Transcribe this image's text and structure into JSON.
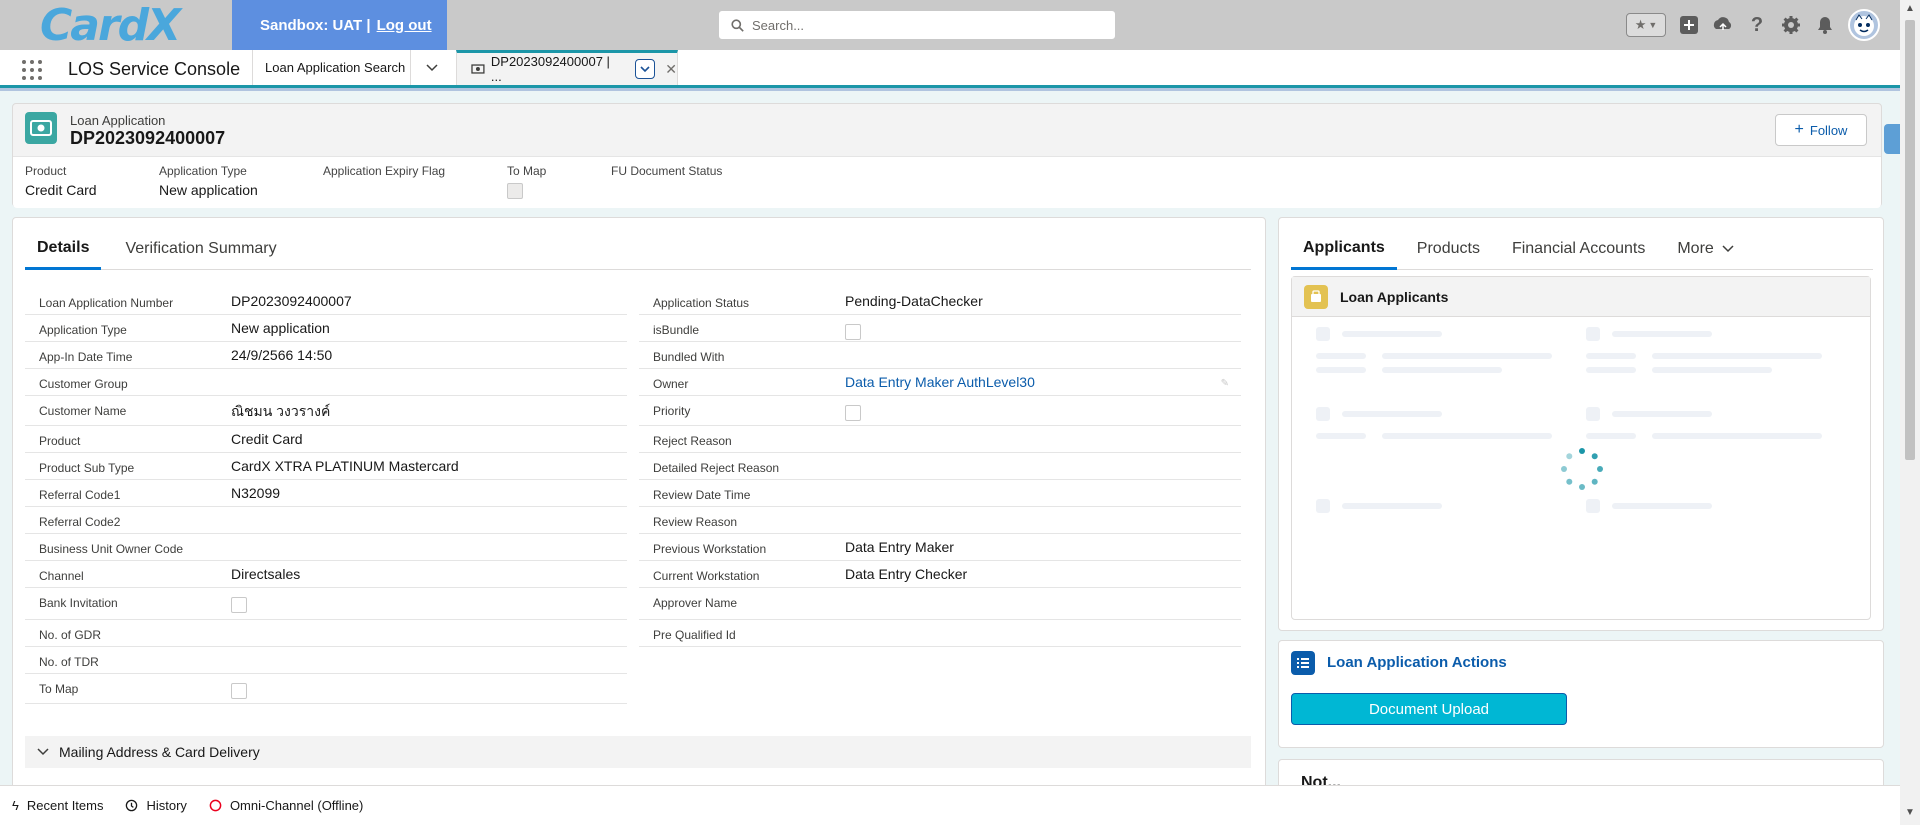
{
  "header": {
    "logo_text": "CardX",
    "sandbox_label": "Sandbox: UAT |",
    "logout_label": "Log out",
    "search_placeholder": "Search..."
  },
  "console": {
    "app_name": "LOS Service Console",
    "tabs": [
      {
        "label": "Loan Application Search"
      },
      {
        "label": "DP2023092400007 | ..."
      }
    ]
  },
  "record": {
    "object_type": "Loan Application",
    "title": "DP2023092400007",
    "follow_label": "Follow",
    "highlights": [
      {
        "label": "Product",
        "value": "Credit Card"
      },
      {
        "label": "Application Type",
        "value": "New application"
      },
      {
        "label": "Application Expiry Flag",
        "value": ""
      },
      {
        "label": "To Map",
        "value": ""
      },
      {
        "label": "FU Document Status",
        "value": ""
      }
    ]
  },
  "details": {
    "tabs": [
      "Details",
      "Verification Summary"
    ],
    "left_fields": [
      {
        "label": "Loan Application Number",
        "value": "DP2023092400007"
      },
      {
        "label": "Application Type",
        "value": "New application"
      },
      {
        "label": "App-In Date Time",
        "value": "24/9/2566 14:50"
      },
      {
        "label": "Customer Group",
        "value": ""
      },
      {
        "label": "Customer Name",
        "value": "ณิชมน วงวรางค์"
      },
      {
        "label": "Product",
        "value": "Credit Card"
      },
      {
        "label": "Product Sub Type",
        "value": "CardX XTRA PLATINUM Mastercard"
      },
      {
        "label": "Referral Code1",
        "value": "N32099"
      },
      {
        "label": "Referral Code2",
        "value": ""
      },
      {
        "label": "Business Unit Owner Code",
        "value": ""
      },
      {
        "label": "Channel",
        "value": "Directsales"
      },
      {
        "label": "Bank Invitation",
        "value": ""
      },
      {
        "label": "No. of GDR",
        "value": ""
      },
      {
        "label": "No. of TDR",
        "value": ""
      },
      {
        "label": "To Map",
        "value": ""
      }
    ],
    "right_fields": [
      {
        "label": "Application Status",
        "value": "Pending-DataChecker"
      },
      {
        "label": "isBundle",
        "value": ""
      },
      {
        "label": "Bundled With",
        "value": ""
      },
      {
        "label": "Owner",
        "value": "Data Entry Maker AuthLevel30"
      },
      {
        "label": "Priority",
        "value": ""
      },
      {
        "label": "Reject Reason",
        "value": ""
      },
      {
        "label": "Detailed Reject Reason",
        "value": ""
      },
      {
        "label": "Review Date Time",
        "value": ""
      },
      {
        "label": "Review Reason",
        "value": ""
      },
      {
        "label": "Previous Workstation",
        "value": "Data Entry Maker"
      },
      {
        "label": "Current Workstation",
        "value": "Data Entry Checker"
      },
      {
        "label": "Approver Name",
        "value": ""
      },
      {
        "label": "Pre Qualified Id",
        "value": ""
      }
    ],
    "section_title": "Mailing Address & Card Delivery"
  },
  "related": {
    "tabs": [
      "Applicants",
      "Products",
      "Financial Accounts",
      "More"
    ],
    "loan_applicants_title": "Loan Applicants",
    "actions_title": "Loan Application Actions",
    "document_upload_label": "Document Upload",
    "notes_title": "Not..."
  },
  "utility": {
    "recent_items": "Recent Items",
    "history": "History",
    "omni_channel": "Omni-Channel (Offline)"
  },
  "colors": {
    "accent": "#1b96a8",
    "brand_blue": "#0b5cab",
    "sandbox_bg": "#5d8fe0",
    "upload_button": "#00b7d4",
    "offline_red": "#ea001e"
  }
}
